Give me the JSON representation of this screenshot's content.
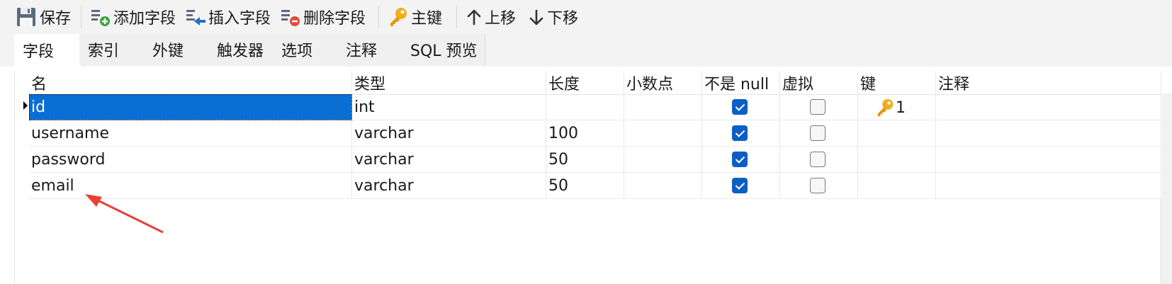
{
  "toolbar": {
    "save": "保存",
    "add_field": "添加字段",
    "insert_field": "插入字段",
    "delete_field": "删除字段",
    "primary_key": "主键",
    "move_up": "上移",
    "move_down": "下移"
  },
  "tabs": [
    {
      "label": "字段",
      "active": true
    },
    {
      "label": "索引",
      "active": false
    },
    {
      "label": "外键",
      "active": false
    },
    {
      "label": "触发器",
      "active": false
    },
    {
      "label": "选项",
      "active": false
    },
    {
      "label": "注释",
      "active": false
    },
    {
      "label": "SQL 预览",
      "active": false
    }
  ],
  "columns": [
    "名",
    "类型",
    "长度",
    "小数点",
    "不是 null",
    "虚拟",
    "键",
    "注释"
  ],
  "rows": [
    {
      "name": "id",
      "type": "int",
      "length": "",
      "decimals": "",
      "not_null": true,
      "virtual": false,
      "key": "1",
      "comment": "",
      "selected": true
    },
    {
      "name": "username",
      "type": "varchar",
      "length": "100",
      "decimals": "",
      "not_null": true,
      "virtual": false,
      "key": "",
      "comment": "",
      "selected": false
    },
    {
      "name": "password",
      "type": "varchar",
      "length": "50",
      "decimals": "",
      "not_null": true,
      "virtual": false,
      "key": "",
      "comment": "",
      "selected": false
    },
    {
      "name": "email",
      "type": "varchar",
      "length": "50",
      "decimals": "",
      "not_null": true,
      "virtual": false,
      "key": "",
      "comment": "",
      "selected": false
    }
  ],
  "colors": {
    "selection": "#0a6fd4",
    "checkbox_on": "#0b5fc4",
    "annotation_arrow": "#e8403a",
    "key_icon": "#e8a317"
  },
  "icons": {
    "save": "save-icon",
    "add_field": "add-field-icon",
    "insert_field": "insert-field-icon",
    "delete_field": "delete-field-icon",
    "primary_key": "key-icon",
    "move_up": "arrow-up-icon",
    "move_down": "arrow-down-icon"
  }
}
